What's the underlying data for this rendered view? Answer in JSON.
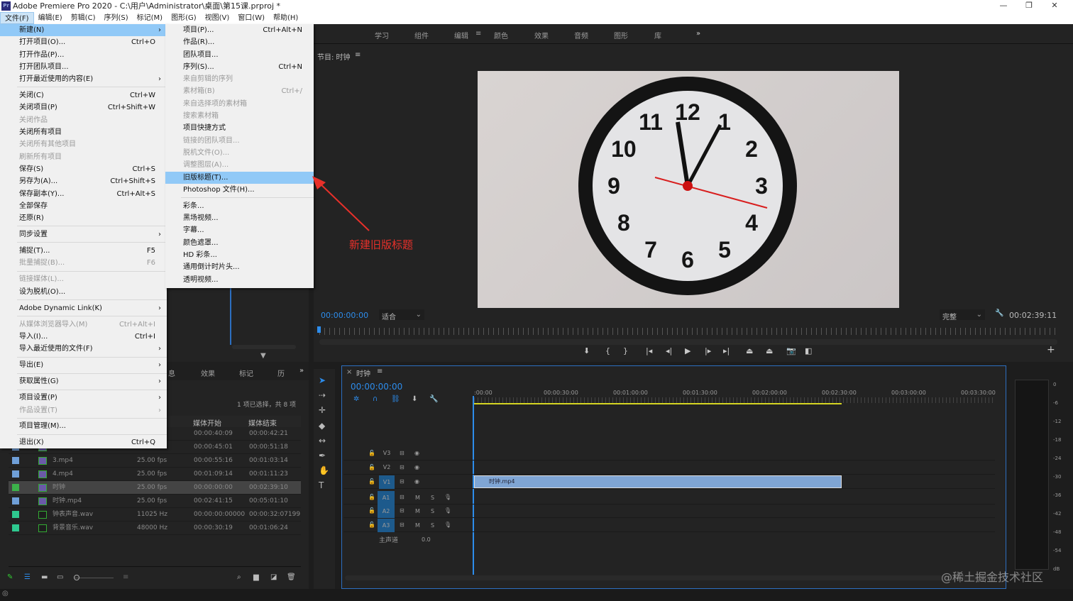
{
  "window": {
    "title": "Adobe Premiere Pro 2020 - C:\\用户\\Administrator\\桌面\\第15课.prproj *",
    "logo": "Pr",
    "minimize": "—",
    "maximize": "❐",
    "close": "✕"
  },
  "menubar": [
    "文件(F)",
    "编辑(E)",
    "剪辑(C)",
    "序列(S)",
    "标记(M)",
    "图形(G)",
    "视图(V)",
    "窗口(W)",
    "帮助(H)"
  ],
  "file_menu": [
    {
      "label": "新建(N)",
      "sub": true,
      "hl": true
    },
    {
      "label": "打开项目(O)...",
      "sc": "Ctrl+O"
    },
    {
      "label": "打开作品(P)..."
    },
    {
      "label": "打开团队项目..."
    },
    {
      "label": "打开最近使用的内容(E)",
      "sub": true
    },
    {
      "sep": true
    },
    {
      "label": "关闭(C)",
      "sc": "Ctrl+W"
    },
    {
      "label": "关闭项目(P)",
      "sc": "Ctrl+Shift+W"
    },
    {
      "label": "关闭作品",
      "dis": true
    },
    {
      "label": "关闭所有项目"
    },
    {
      "label": "关闭所有其他项目",
      "dis": true
    },
    {
      "label": "刷新所有项目",
      "dis": true
    },
    {
      "label": "保存(S)",
      "sc": "Ctrl+S"
    },
    {
      "label": "另存为(A)...",
      "sc": "Ctrl+Shift+S"
    },
    {
      "label": "保存副本(Y)...",
      "sc": "Ctrl+Alt+S"
    },
    {
      "label": "全部保存"
    },
    {
      "label": "还原(R)"
    },
    {
      "sep": true
    },
    {
      "label": "同步设置",
      "sub": true
    },
    {
      "sep": true
    },
    {
      "label": "捕捉(T)...",
      "sc": "F5"
    },
    {
      "label": "批量捕捉(B)...",
      "sc": "F6",
      "dis": true
    },
    {
      "sep": true
    },
    {
      "label": "链接媒体(L)...",
      "dis": true
    },
    {
      "label": "设为脱机(O)..."
    },
    {
      "sep": true
    },
    {
      "label": "Adobe Dynamic Link(K)",
      "sub": true
    },
    {
      "sep": true
    },
    {
      "label": "从媒体浏览器导入(M)",
      "sc": "Ctrl+Alt+I",
      "dis": true
    },
    {
      "label": "导入(I)...",
      "sc": "Ctrl+I"
    },
    {
      "label": "导入最近使用的文件(F)",
      "sub": true
    },
    {
      "sep": true
    },
    {
      "label": "导出(E)",
      "sub": true
    },
    {
      "sep": true
    },
    {
      "label": "获取属性(G)",
      "sub": true
    },
    {
      "sep": true
    },
    {
      "label": "项目设置(P)",
      "sub": true
    },
    {
      "label": "作品设置(T)",
      "sub": true,
      "dis": true
    },
    {
      "sep": true
    },
    {
      "label": "项目管理(M)..."
    },
    {
      "sep": true
    },
    {
      "label": "退出(X)",
      "sc": "Ctrl+Q"
    }
  ],
  "new_submenu": [
    {
      "label": "项目(P)...",
      "sc": "Ctrl+Alt+N"
    },
    {
      "label": "作品(R)..."
    },
    {
      "label": "团队项目..."
    },
    {
      "label": "序列(S)...",
      "sc": "Ctrl+N"
    },
    {
      "label": "来自剪辑的序列",
      "dis": true
    },
    {
      "label": "素材箱(B)",
      "sc": "Ctrl+/",
      "dis": true
    },
    {
      "label": "来自选择项的素材箱",
      "dis": true
    },
    {
      "label": "搜索素材箱",
      "dis": true
    },
    {
      "label": "项目快捷方式"
    },
    {
      "label": "链接的团队项目...",
      "dis": true
    },
    {
      "label": "脱机文件(O)...",
      "dis": true
    },
    {
      "label": "调整图层(A)...",
      "dis": true
    },
    {
      "label": "旧版标题(T)...",
      "hl": true
    },
    {
      "label": "Photoshop 文件(H)..."
    },
    {
      "sep": true
    },
    {
      "label": "彩条..."
    },
    {
      "label": "黑场视频..."
    },
    {
      "label": "字幕..."
    },
    {
      "label": "颜色遮罩..."
    },
    {
      "label": "HD 彩条..."
    },
    {
      "label": "通用倒计时片头..."
    },
    {
      "label": "透明视频..."
    }
  ],
  "annotation": {
    "text": "新建旧版标题",
    "color": "#e8302a"
  },
  "workspace_tabs": [
    "学习",
    "组件",
    "编辑",
    "颜色",
    "效果",
    "音频",
    "图形",
    "库"
  ],
  "workspace_active": "编辑",
  "workspace_more": "»",
  "panel_menu_icon": "≡",
  "program": {
    "title": "节目: 时钟",
    "timecode": "00:00:00:00",
    "zoom": "适合",
    "quality": "完整",
    "duration": "00:02:39:11"
  },
  "project": {
    "tabs": [
      "息",
      "效果",
      "标记",
      "历"
    ],
    "more": "»",
    "selection": "1 项已选择，共 8 项",
    "col_start": "媒体开始",
    "col_end": "媒体结束",
    "rows": [
      {
        "name": "",
        "rate": "",
        "start": "00:00:40:09",
        "end": "00:00:42:21",
        "color": "#6f9fd8"
      },
      {
        "name": "",
        "rate": "",
        "start": "00:00:45:01",
        "end": "00:00:51:18",
        "color": "#6f9fd8"
      },
      {
        "name": "3.mp4",
        "rate": "25.00 fps",
        "start": "00:00:55:16",
        "end": "00:01:03:14",
        "color": "#6f9fd8"
      },
      {
        "name": "4.mp4",
        "rate": "25.00 fps",
        "start": "00:01:09:14",
        "end": "00:01:11:23",
        "color": "#6f9fd8"
      },
      {
        "name": "时钟",
        "rate": "25.00 fps",
        "start": "00:00:00:00",
        "end": "00:02:39:10",
        "color": "#3cb04a",
        "selected": true
      },
      {
        "name": "时钟.mp4",
        "rate": "25.00 fps",
        "start": "00:02:41:15",
        "end": "00:05:01:10",
        "color": "#6f9fd8"
      },
      {
        "name": "钟表声音.wav",
        "rate": "11025 Hz",
        "start": "00:00:00:00000",
        "end": "00:00:32:07199",
        "color": "#2ec98f"
      },
      {
        "name": "背景音乐.wav",
        "rate": "48000 Hz",
        "start": "00:00:30:19",
        "end": "00:01:06:24",
        "color": "#2ec98f"
      }
    ]
  },
  "timeline": {
    "close": "×",
    "title": "时钟",
    "timecode": "00:00:00:00",
    "ruler": [
      ":00:00",
      "00:00:30:00",
      "00:01:00:00",
      "00:01:30:00",
      "00:02:00:00",
      "00:02:30:00",
      "00:03:00:00",
      "00:03:30:00"
    ],
    "video_tracks": [
      "V3",
      "V2",
      "V1"
    ],
    "audio_tracks": [
      "A1",
      "A2",
      "A3"
    ],
    "master": "主声道",
    "master_value": "0.0",
    "clip": "时钟.mp4",
    "m": "M",
    "s": "S"
  },
  "meter": [
    "0",
    "-6",
    "-12",
    "-18",
    "-24",
    "-30",
    "-36",
    "-42",
    "-48",
    "-54",
    "dB"
  ],
  "watermark": "@稀土掘金技术社区",
  "clock_numbers": [
    "12",
    "1",
    "2",
    "3",
    "4",
    "5",
    "6",
    "7",
    "8",
    "9",
    "10",
    "11"
  ]
}
